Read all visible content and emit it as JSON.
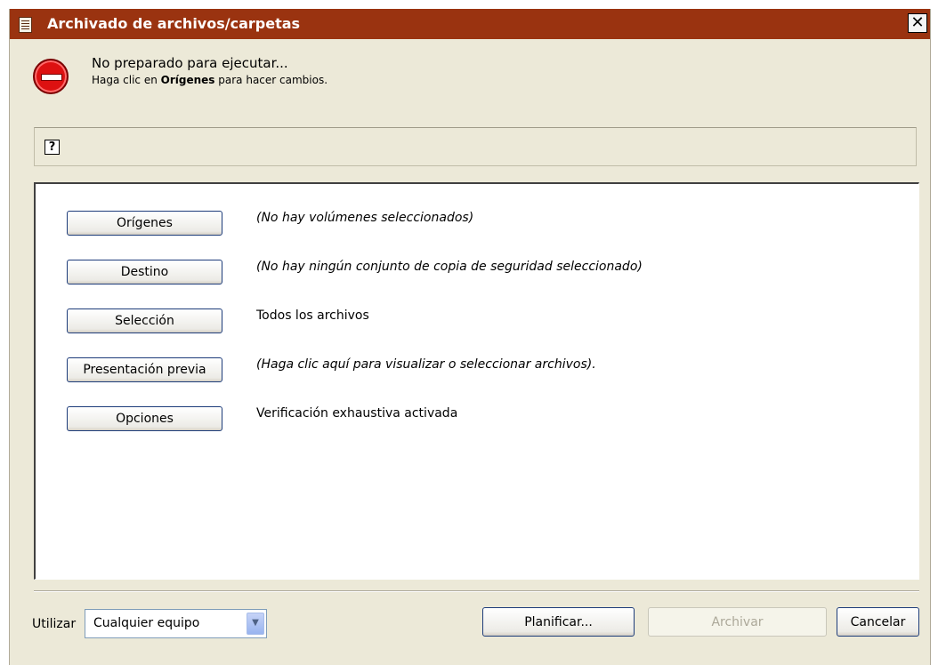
{
  "window": {
    "title": "Archivado de archivos/carpetas",
    "close_glyph": "✕"
  },
  "status": {
    "line1": "No preparado para ejecutar...",
    "line2_prefix": "Haga clic en ",
    "line2_bold": "Orígenes",
    "line2_suffix": " para hacer cambios."
  },
  "help": {
    "icon_glyph": "?"
  },
  "rows": [
    {
      "button": "Orígenes",
      "description": "(No hay volúmenes seleccionados)"
    },
    {
      "button": "Destino",
      "description": "(No hay ningún conjunto de copia de seguridad seleccionado)"
    },
    {
      "button": "Selección",
      "description": "Todos los archivos"
    },
    {
      "button": "Presentación previa",
      "description": "(Haga clic aquí para visualizar o seleccionar archivos)."
    },
    {
      "button": "Opciones",
      "description": "Verificación exhaustiva activada"
    }
  ],
  "footer": {
    "use_label": "Utilizar",
    "machine_value": "Cualquier equipo",
    "schedule_button": "Planificar...",
    "archive_button": "Archivar",
    "cancel_button": "Cancelar"
  },
  "icons": {
    "title": "document-icon",
    "status": "stop-icon",
    "help": "help-icon",
    "dropdown": "chevron-down-icon"
  },
  "colors": {
    "titlebar": "#9a3310",
    "dialog_background": "#ece9d8",
    "stop_icon": "#dd1111"
  }
}
